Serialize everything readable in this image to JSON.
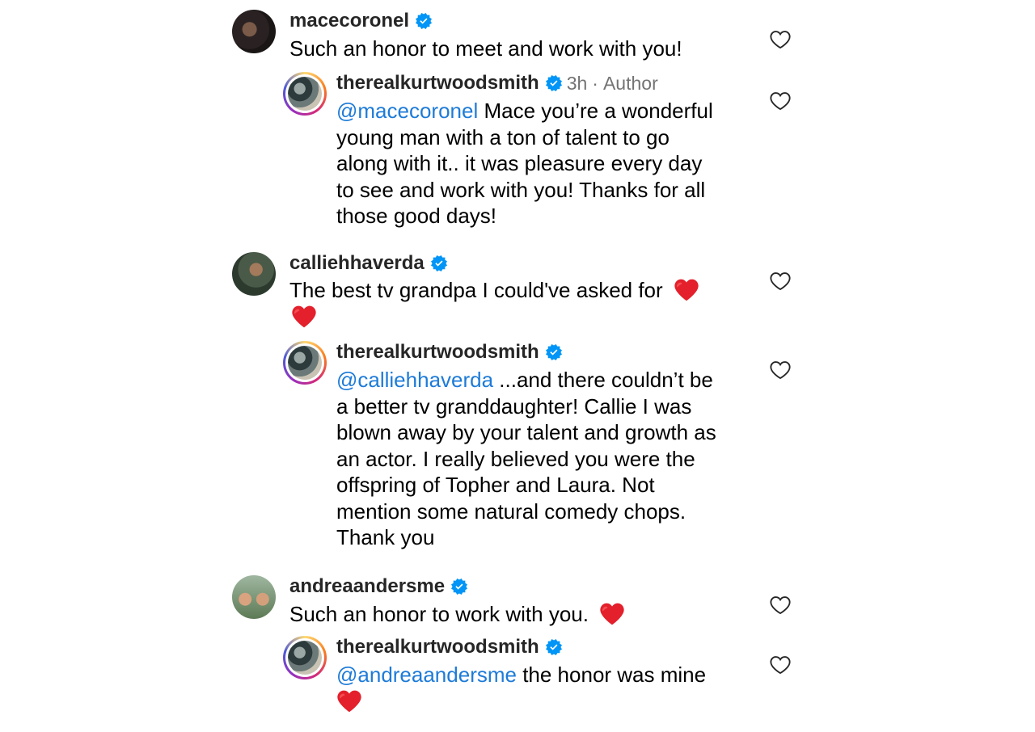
{
  "comments": [
    {
      "username": "macecoronel",
      "text": "Such an honor to meet and work with you!",
      "reply": {
        "username": "therealkurtwoodsmith",
        "time": "3h",
        "separator": "·",
        "badge": "Author",
        "mention": "@macecoronel",
        "text_lines": [
          " Mace you’re a wonderful",
          "young man with a ton of talent to go",
          "along with it.. it was pleasure every day",
          "to see and work with you! Thanks for all",
          "those good days!"
        ]
      }
    },
    {
      "username": "calliehhaverda",
      "text": "The best tv grandpa I could've asked for",
      "reply": {
        "username": "therealkurtwoodsmith",
        "mention": "@calliehhaverda",
        "text_lines": [
          " ...and there couldn’t be",
          "a better tv granddaughter! Callie I was",
          "blown away by your talent and growth as",
          "an actor. I really believed you were the",
          "offspring of Topher and Laura. Not",
          "mention some natural comedy chops.",
          "Thank you"
        ]
      }
    },
    {
      "username": "andreaandersme",
      "text": "Such an honor to work with you.",
      "reply": {
        "username": "therealkurtwoodsmith",
        "mention": "@andreaandersme",
        "text": " the honor was mine"
      }
    }
  ],
  "colors": {
    "mention": "#1d7bd8",
    "verified": "#0095f6",
    "heart_emoji": "#e3202b"
  },
  "icons": [
    "verified-badge-icon",
    "like-heart-icon",
    "red-heart-emoji"
  ]
}
